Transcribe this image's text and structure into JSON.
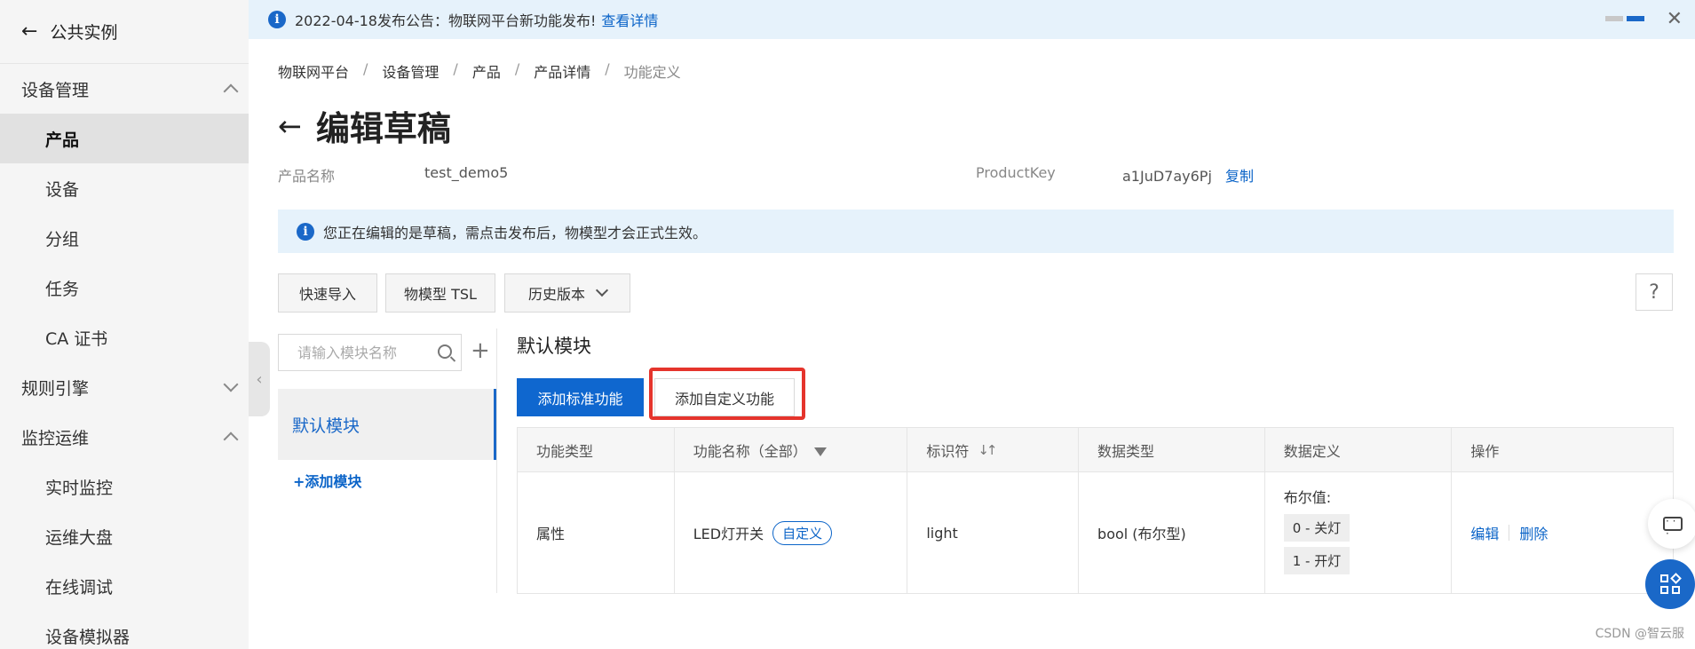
{
  "sidebar": {
    "back_label": "公共实例",
    "groups": [
      {
        "label": "设备管理",
        "expanded": true,
        "items": [
          "产品",
          "设备",
          "分组",
          "任务",
          "CA 证书"
        ]
      },
      {
        "label": "规则引擎",
        "expanded": false,
        "items": []
      },
      {
        "label": "监控运维",
        "expanded": true,
        "items": [
          "实时监控",
          "运维大盘",
          "在线调试",
          "设备模拟器"
        ]
      }
    ],
    "active_item": "产品"
  },
  "notice": {
    "text": "2022-04-18发布公告：物联网平台新功能发布!",
    "link": "查看详情"
  },
  "breadcrumb": [
    "物联网平台",
    "设备管理",
    "产品",
    "产品详情",
    "功能定义"
  ],
  "page_title": "编辑草稿",
  "meta": {
    "product_name_label": "产品名称",
    "product_name_value": "test_demo5",
    "product_key_label": "ProductKey",
    "product_key_value": "a1JuD7ay6Pj",
    "copy_label": "复制"
  },
  "tip_text": "您正在编辑的是草稿，需点击发布后，物模型才会正式生效。",
  "toolbar": {
    "quick_import": "快速导入",
    "tsl": "物模型 TSL",
    "history": "历史版本",
    "help": "?"
  },
  "modules": {
    "search_placeholder": "请输入模块名称",
    "items": [
      "默认模块"
    ],
    "add_label": "+添加模块"
  },
  "main": {
    "module_title": "默认模块",
    "add_standard": "添加标准功能",
    "add_custom": "添加自定义功能",
    "table": {
      "headers": [
        "功能类型",
        "功能名称（全部）",
        "标识符",
        "数据类型",
        "数据定义",
        "操作"
      ],
      "rows": [
        {
          "type": "属性",
          "name": "LED灯开关",
          "tag": "自定义",
          "identifier": "light",
          "data_type": "bool (布尔型)",
          "def_label": "布尔值:",
          "def_values": [
            "0 - 关灯",
            "1 - 开灯"
          ],
          "ops": [
            "编辑",
            "删除"
          ]
        }
      ]
    }
  },
  "watermark": "CSDN @智云服",
  "colors": {
    "accent": "#1a68c8",
    "highlight": "#e5342c",
    "notice_bg": "#e6f2fb"
  }
}
